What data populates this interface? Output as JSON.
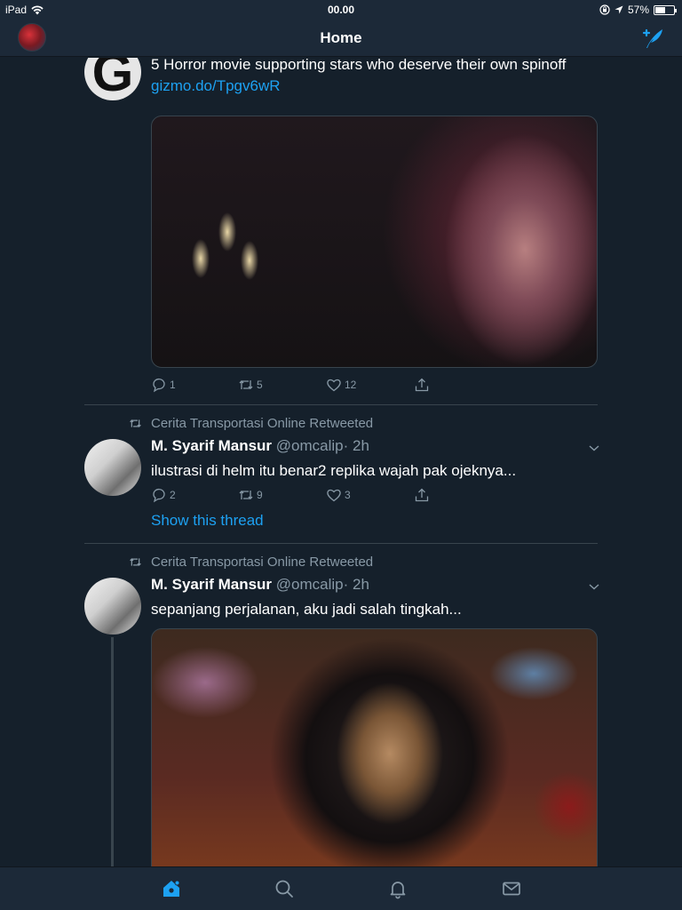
{
  "status_bar": {
    "device": "iPad",
    "time": "00.00",
    "battery": "57%",
    "battery_level": 0.57
  },
  "nav": {
    "title": "Home"
  },
  "tweets": [
    {
      "avatar_letter": "G",
      "text": "5 Horror movie supporting stars who deserve their own spinoff ",
      "link": "gizmo.do/Tpgv6wR",
      "replies": "1",
      "retweets": "5",
      "likes": "12"
    },
    {
      "retweeted_by": "Cerita Transportasi Online Retweeted",
      "name": "M. Syarif Mansur",
      "handle": "@omcalip",
      "time": "· 2h",
      "text": "ilustrasi di helm itu benar2 replika wajah pak ojeknya...",
      "replies": "2",
      "retweets": "9",
      "likes": "3",
      "thread_link": "Show this thread"
    },
    {
      "retweeted_by": "Cerita Transportasi Online Retweeted",
      "name": "M. Syarif Mansur",
      "handle": "@omcalip",
      "time": "· 2h",
      "text": "sepanjang perjalanan, aku jadi salah tingkah..."
    }
  ],
  "colors": {
    "background": "#15202b",
    "bar": "#1c2938",
    "accent": "#1da1f2",
    "muted": "#8899a6",
    "divider": "#38444d"
  },
  "tabs": [
    {
      "icon": "home-icon",
      "active": true
    },
    {
      "icon": "search-icon",
      "active": false
    },
    {
      "icon": "bell-icon",
      "active": false
    },
    {
      "icon": "mail-icon",
      "active": false
    }
  ]
}
